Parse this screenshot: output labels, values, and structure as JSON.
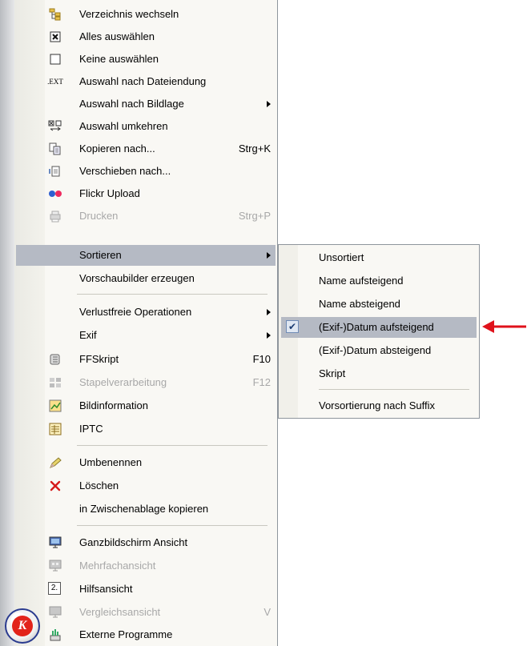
{
  "main_menu": {
    "items": [
      {
        "label": "Verzeichnis wechseln",
        "icon": "folder-tree-icon"
      },
      {
        "label": "Alles auswählen",
        "icon": "select-all-icon"
      },
      {
        "label": "Keine auswählen",
        "icon": "select-none-icon"
      },
      {
        "label": "Auswahl nach Dateiendung",
        "icon": "file-extension-icon",
        "icon_text": ".EXT"
      },
      {
        "label": "Auswahl nach Bildlage",
        "submenu": true
      },
      {
        "label": "Auswahl umkehren",
        "icon": "invert-selection-icon"
      },
      {
        "label": "Kopieren nach...",
        "shortcut": "Strg+K",
        "icon": "copy-to-icon"
      },
      {
        "label": "Verschieben nach...",
        "icon": "move-to-icon"
      },
      {
        "label": "Flickr Upload",
        "icon": "flickr-icon"
      },
      {
        "label": "Drucken",
        "shortcut": "Strg+P",
        "icon": "printer-icon",
        "disabled": true
      },
      {
        "label": "Sortieren",
        "submenu": true,
        "highlighted": true
      },
      {
        "label": "Vorschaubilder erzeugen"
      },
      {
        "label": "Verlustfreie Operationen",
        "submenu": true
      },
      {
        "label": "Exif",
        "submenu": true
      },
      {
        "label": "FFSkript",
        "shortcut": "F10",
        "icon": "script-icon"
      },
      {
        "label": "Stapelverarbeitung",
        "shortcut": "F12",
        "icon": "batch-icon",
        "disabled": true
      },
      {
        "label": "Bildinformation",
        "icon": "image-info-icon"
      },
      {
        "label": "IPTC",
        "icon": "iptc-icon"
      },
      {
        "label": "Umbenennen",
        "icon": "rename-pencil-icon"
      },
      {
        "label": "Löschen",
        "icon": "delete-x-icon"
      },
      {
        "label": "in Zwischenablage kopieren"
      },
      {
        "label": "Ganzbildschirm Ansicht",
        "icon": "fullscreen-monitor-icon"
      },
      {
        "label": "Mehrfachansicht",
        "icon": "multi-view-icon",
        "disabled": true
      },
      {
        "label": "Hilfsansicht",
        "icon": "helper-view-icon",
        "icon_text": "2."
      },
      {
        "label": "Vergleichsansicht",
        "shortcut": "V",
        "icon": "compare-view-icon",
        "disabled": true
      },
      {
        "label": "Externe Programme",
        "icon": "external-programs-icon"
      }
    ]
  },
  "sort_submenu": {
    "items": [
      {
        "label": "Unsortiert"
      },
      {
        "label": "Name aufsteigend"
      },
      {
        "label": "Name absteigend"
      },
      {
        "label": "(Exif-)Datum aufsteigend",
        "checked": true,
        "highlighted": true
      },
      {
        "label": "(Exif-)Datum absteigend"
      },
      {
        "label": "Skript"
      },
      {
        "label": "Vorsortierung nach Suffix"
      }
    ],
    "check_mark": "✔"
  },
  "app_logo": {
    "letter": "K"
  },
  "colors": {
    "highlight": "#b5bac4",
    "menu_bg": "#f9f8f4",
    "disabled_text": "#a8a8a8",
    "annotation_arrow": "#e0121b"
  }
}
